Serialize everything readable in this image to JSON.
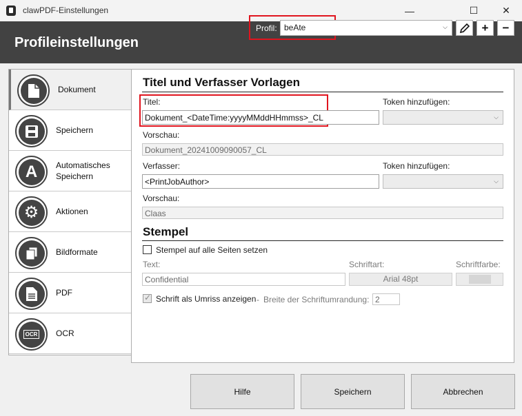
{
  "window": {
    "title": "clawPDF-Einstellungen",
    "controls": [
      "—",
      "☐",
      "✕"
    ]
  },
  "header": {
    "title": "Profileinstellungen",
    "profile_label": "Profil:",
    "profile_value": "beAte",
    "buttons": [
      "edit-icon",
      "add-icon",
      "remove-icon"
    ]
  },
  "sidebar": {
    "items": [
      {
        "label": "Dokument",
        "icon": "document-icon",
        "glyph": "🗎"
      },
      {
        "label": "Speichern",
        "icon": "save-icon",
        "glyph": "💾"
      },
      {
        "label": "Automatisches Speichern",
        "icon": "auto-save-icon",
        "glyph": "A"
      },
      {
        "label": "Aktionen",
        "icon": "gear-icon",
        "glyph": "⚙"
      },
      {
        "label": "Bildformate",
        "icon": "image-formats-icon",
        "glyph": "❐"
      },
      {
        "label": "PDF",
        "icon": "pdf-icon",
        "glyph": "🗎"
      },
      {
        "label": "OCR",
        "icon": "ocr-icon",
        "glyph": "OCR"
      }
    ]
  },
  "document": {
    "section_title": "Titel und Verfasser Vorlagen",
    "title_label": "Titel:",
    "title_value": "Dokument_<DateTime:yyyyMMddHHmmss>_CL",
    "token_label_1": "Token hinzufügen:",
    "preview_label_1": "Vorschau:",
    "preview_value_1": "Dokument_20241009090057_CL",
    "author_label": "Verfasser:",
    "author_value": "<PrintJobAuthor>",
    "token_label_2": "Token hinzufügen:",
    "preview_label_2": "Vorschau:",
    "preview_value_2": "Claas"
  },
  "stamp": {
    "section_title": "Stempel",
    "all_pages_label": "Stempel auf alle Seiten setzen",
    "all_pages_checked": false,
    "text_label": "Text:",
    "text_value": "Confidential",
    "font_label": "Schriftart:",
    "font_value": "Arial 48pt",
    "color_label": "Schriftfarbe:",
    "outline_label": "Schrift als Umriss anzeigen",
    "outline_checked": true,
    "separator": "-",
    "outline_width_label": "Breite der Schriftumrandung:",
    "outline_width_value": "2"
  },
  "footer": {
    "help": "Hilfe",
    "save": "Speichern",
    "cancel": "Abbrechen"
  },
  "colors": {
    "header_bg": "#424242",
    "highlight": "#e0141e"
  }
}
